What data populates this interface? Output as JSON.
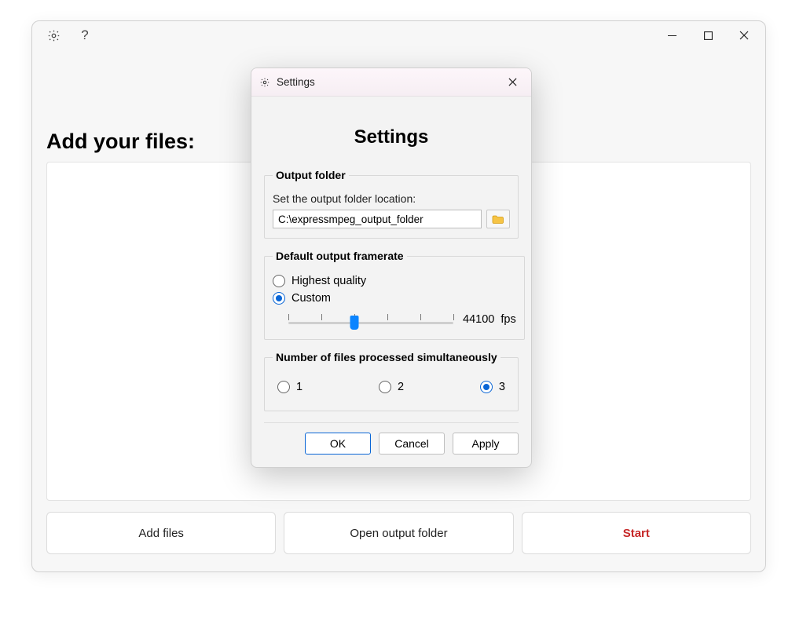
{
  "mainWindow": {
    "heading": "Add your files:",
    "buttons": {
      "addFiles": "Add files",
      "openOutput": "Open output folder",
      "start": "Start"
    }
  },
  "dialog": {
    "title": "Settings",
    "heading": "Settings",
    "outputFolder": {
      "legend": "Output folder",
      "desc": "Set the output folder location:",
      "path": "C:\\expressmpeg_output_folder"
    },
    "framerate": {
      "legend": "Default output framerate",
      "optionHighest": "Highest quality",
      "optionCustom": "Custom",
      "selected": "custom",
      "value": "44100",
      "unit": "fps",
      "thumbPercent": 40
    },
    "simultaneous": {
      "legend": "Number of files processed simultaneously",
      "options": [
        "1",
        "2",
        "3"
      ],
      "selected": "3"
    },
    "buttons": {
      "ok": "OK",
      "cancel": "Cancel",
      "apply": "Apply"
    }
  }
}
